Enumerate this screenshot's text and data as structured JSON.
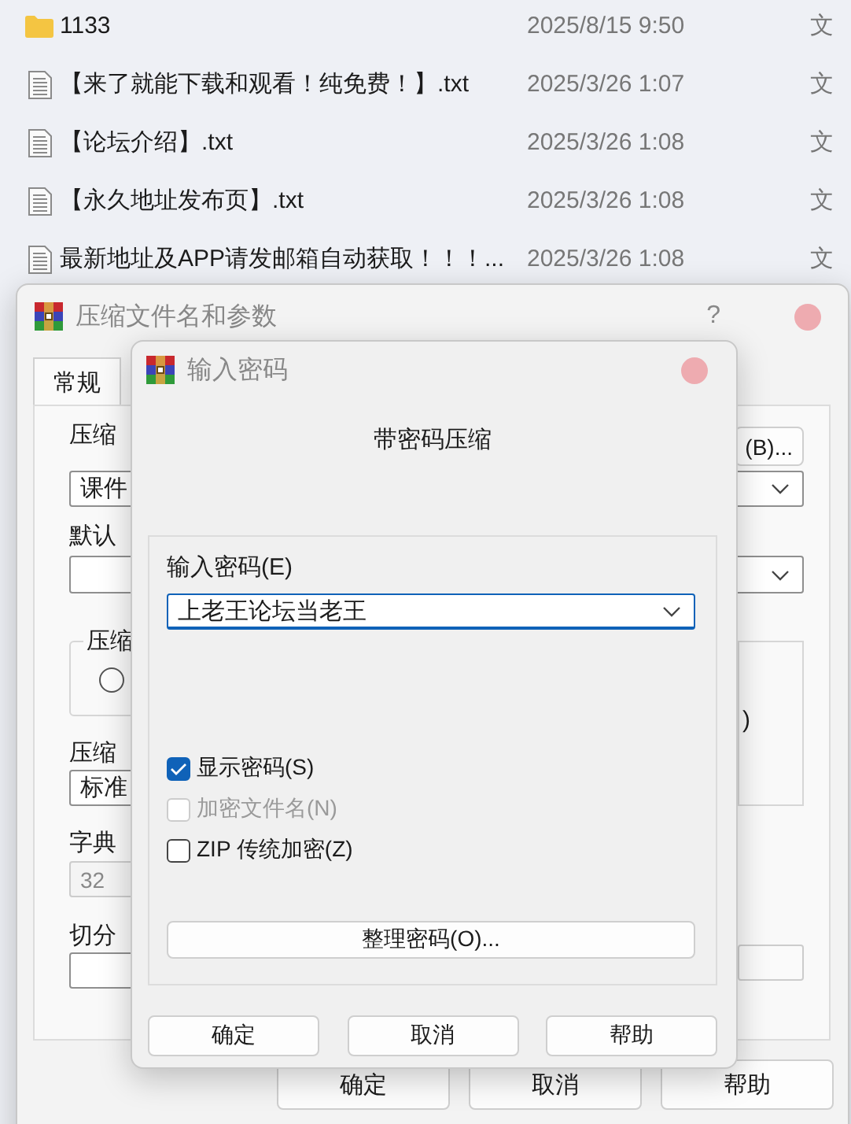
{
  "file_list": {
    "rows": [
      {
        "kind": "folder",
        "name": "1133",
        "date": "2025/8/15 9:50",
        "type": "文"
      },
      {
        "kind": "text",
        "name": "【来了就能下载和观看！纯免费！】.txt",
        "date": "2025/3/26 1:07",
        "type": "文"
      },
      {
        "kind": "text",
        "name": "【论坛介绍】.txt",
        "date": "2025/3/26 1:08",
        "type": "文"
      },
      {
        "kind": "text",
        "name": "【永久地址发布页】.txt",
        "date": "2025/3/26 1:08",
        "type": "文"
      },
      {
        "kind": "text",
        "name": "最新地址及APP请发邮箱自动获取！！！...",
        "date": "2025/3/26 1:08",
        "type": "文"
      }
    ]
  },
  "archive_dialog": {
    "title": "压缩文件名和参数",
    "help_button": "?",
    "tabs": [
      {
        "label": "常规",
        "selected": true
      }
    ],
    "archive_name_label": "压缩",
    "browse_button": "(B)...",
    "archive_name": "课件",
    "profile_label": "默认",
    "format_group_label": "压缩",
    "format_radio": {
      "selected": false
    },
    "right_group_text": ")",
    "method_label": "压缩",
    "method": "标准",
    "dictionary_label": "字典",
    "dictionary": {
      "value": "32",
      "disabled": true
    },
    "split_label": "切分",
    "buttons": [
      "确定",
      "取消",
      "帮助"
    ]
  },
  "password_dialog": {
    "title": "输入密码",
    "heading": "带密码压缩",
    "password_label": "输入密码(E)",
    "password": "上老王论坛当老王",
    "options": [
      {
        "label": "显示密码(S)",
        "checked": true,
        "disabled": false
      },
      {
        "label": "加密文件名(N)",
        "checked": false,
        "disabled": true
      },
      {
        "label": "ZIP 传统加密(Z)",
        "checked": false,
        "disabled": false
      }
    ],
    "organize_button": "整理密码(O)...",
    "buttons": [
      "确定",
      "取消",
      "帮助"
    ]
  }
}
